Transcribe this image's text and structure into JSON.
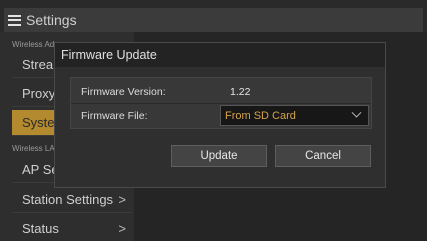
{
  "app": {
    "title": "Settings"
  },
  "sidebar": {
    "sections": [
      {
        "label": "Wireless Ad"
      },
      {
        "label": "Wireless LA"
      }
    ],
    "items": [
      {
        "label": "Stream",
        "active": false
      },
      {
        "label": "Proxy",
        "active": false
      },
      {
        "label": "Syster",
        "active": true
      },
      {
        "label": "AP Set",
        "active": false
      },
      {
        "label": "Station Settings",
        "chevron": ">"
      },
      {
        "label": "Status",
        "chevron": ">"
      }
    ]
  },
  "dialog": {
    "title": "Firmware Update",
    "rows": [
      {
        "label": "Firmware Version:",
        "value": "1.22"
      },
      {
        "label": "Firmware File:",
        "value": "From SD Card"
      }
    ],
    "buttons": {
      "update": "Update",
      "cancel": "Cancel"
    }
  },
  "colors": {
    "accent": "#b38a2e",
    "select_text": "#d4a24c"
  }
}
